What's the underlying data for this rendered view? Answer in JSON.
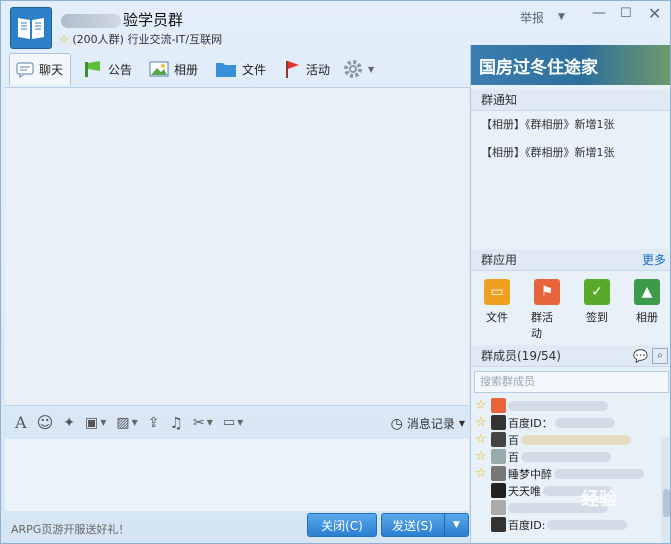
{
  "group": {
    "name": "验学员群",
    "subtitle": "(200人群) 行业交流-IT/互联网"
  },
  "window": {
    "report": "举报"
  },
  "tabs": [
    {
      "label": "聊天"
    },
    {
      "label": "公告"
    },
    {
      "label": "相册"
    },
    {
      "label": "文件"
    },
    {
      "label": "活动"
    }
  ],
  "toolbar": {
    "history": "消息记录"
  },
  "footer": {
    "ad": "ARPG页游开服送好礼！",
    "close": "关闭(C)",
    "send": "发送(S)"
  },
  "banner": {
    "text": "国房过冬住途家"
  },
  "notice": {
    "title": "群通知",
    "items": [
      "【相册】《群相册》新增1张",
      "【相册】《群相册》新增1张"
    ]
  },
  "apps": {
    "title": "群应用",
    "more": "更多",
    "items": [
      {
        "label": "文件",
        "color": "#f0a020"
      },
      {
        "label": "群活动",
        "color": "#e8643c"
      },
      {
        "label": "签到",
        "color": "#5aaa2a"
      },
      {
        "label": "相册",
        "color": "#3c9a4a"
      }
    ]
  },
  "members": {
    "title": "群成员(19/54)",
    "search_placeholder": "搜索群成员",
    "list": [
      {
        "name": "百度ID：",
        "star": true
      },
      {
        "name": "百",
        "star": true
      },
      {
        "name": "百",
        "star": true
      },
      {
        "name": "睡梦中醉",
        "star": true
      },
      {
        "name": "天天唯",
        "star": false
      },
      {
        "name": "",
        "star": false
      },
      {
        "name": "百度ID:",
        "star": false
      }
    ]
  },
  "watermark": "经验"
}
